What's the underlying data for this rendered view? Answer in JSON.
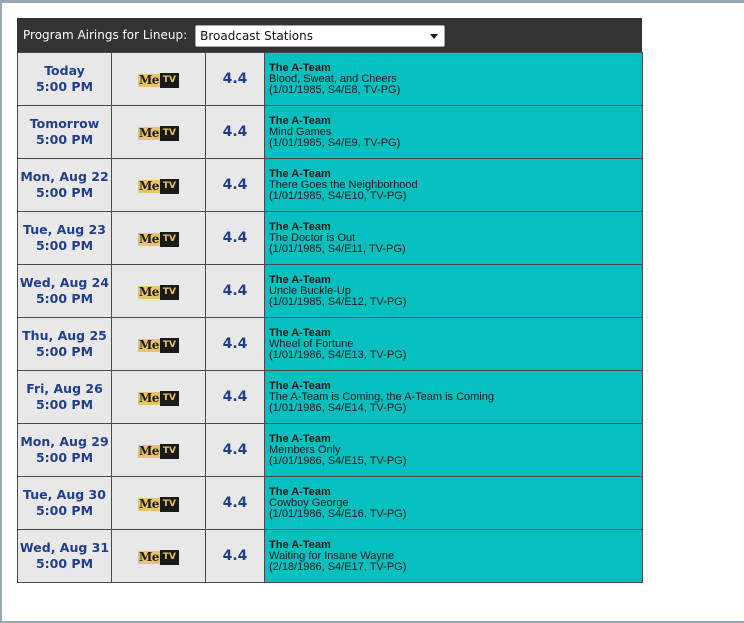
{
  "header": {
    "label": "Program Airings for Lineup:",
    "lineup_selected": "Broadcast Stations"
  },
  "colors": {
    "header_bg": "#333333",
    "row_bg": "#e8e8e8",
    "program_bg": "#06bfbf",
    "date_text": "#1f3f8c"
  },
  "columns": [
    "date_time",
    "network_logo",
    "channel",
    "program"
  ],
  "airings": [
    {
      "day": "Today",
      "time": "5:00 PM",
      "network": "MeTV",
      "channel": "4.4",
      "show": "The A-Team",
      "episode": "Blood, Sweat, and Cheers",
      "meta": "(1/01/1985, S4/E8, TV-PG)"
    },
    {
      "day": "Tomorrow",
      "time": "5:00 PM",
      "network": "MeTV",
      "channel": "4.4",
      "show": "The A-Team",
      "episode": "Mind Games",
      "meta": "(1/01/1985, S4/E9, TV-PG)"
    },
    {
      "day": "Mon, Aug 22",
      "time": "5:00 PM",
      "network": "MeTV",
      "channel": "4.4",
      "show": "The A-Team",
      "episode": "There Goes the Neighborhood",
      "meta": "(1/01/1985, S4/E10, TV-PG)"
    },
    {
      "day": "Tue, Aug 23",
      "time": "5:00 PM",
      "network": "MeTV",
      "channel": "4.4",
      "show": "The A-Team",
      "episode": "The Doctor is Out",
      "meta": "(1/01/1985, S4/E11, TV-PG)"
    },
    {
      "day": "Wed, Aug 24",
      "time": "5:00 PM",
      "network": "MeTV",
      "channel": "4.4",
      "show": "The A-Team",
      "episode": "Uncle Buckle-Up",
      "meta": "(1/01/1985, S4/E12, TV-PG)"
    },
    {
      "day": "Thu, Aug 25",
      "time": "5:00 PM",
      "network": "MeTV",
      "channel": "4.4",
      "show": "The A-Team",
      "episode": "Wheel of Fortune",
      "meta": "(1/01/1986, S4/E13, TV-PG)"
    },
    {
      "day": "Fri, Aug 26",
      "time": "5:00 PM",
      "network": "MeTV",
      "channel": "4.4",
      "show": "The A-Team",
      "episode": "The A-Team is Coming, the A-Team is Coming",
      "meta": "(1/01/1986, S4/E14, TV-PG)"
    },
    {
      "day": "Mon, Aug 29",
      "time": "5:00 PM",
      "network": "MeTV",
      "channel": "4.4",
      "show": "The A-Team",
      "episode": "Members Only",
      "meta": "(1/01/1986, S4/E15, TV-PG)"
    },
    {
      "day": "Tue, Aug 30",
      "time": "5:00 PM",
      "network": "MeTV",
      "channel": "4.4",
      "show": "The A-Team",
      "episode": "Cowboy George",
      "meta": "(1/01/1986, S4/E16, TV-PG)"
    },
    {
      "day": "Wed, Aug 31",
      "time": "5:00 PM",
      "network": "MeTV",
      "channel": "4.4",
      "show": "The A-Team",
      "episode": "Waiting for Insane Wayne",
      "meta": "(2/18/1986, S4/E17, TV-PG)"
    }
  ]
}
